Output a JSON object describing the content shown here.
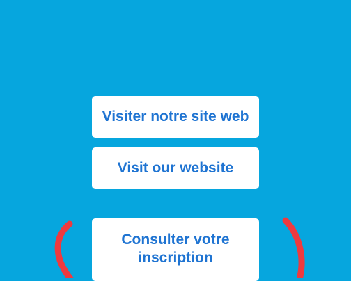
{
  "colors": {
    "background": "#06a6de",
    "button_background": "#ffffff",
    "button_text": "#1f74d2",
    "annotation": "#ee3a3f"
  },
  "buttons": {
    "visit_site_fr": "Visiter notre site web",
    "visit_site_en": "Visit our website",
    "registration": "Consulter votre inscription"
  }
}
